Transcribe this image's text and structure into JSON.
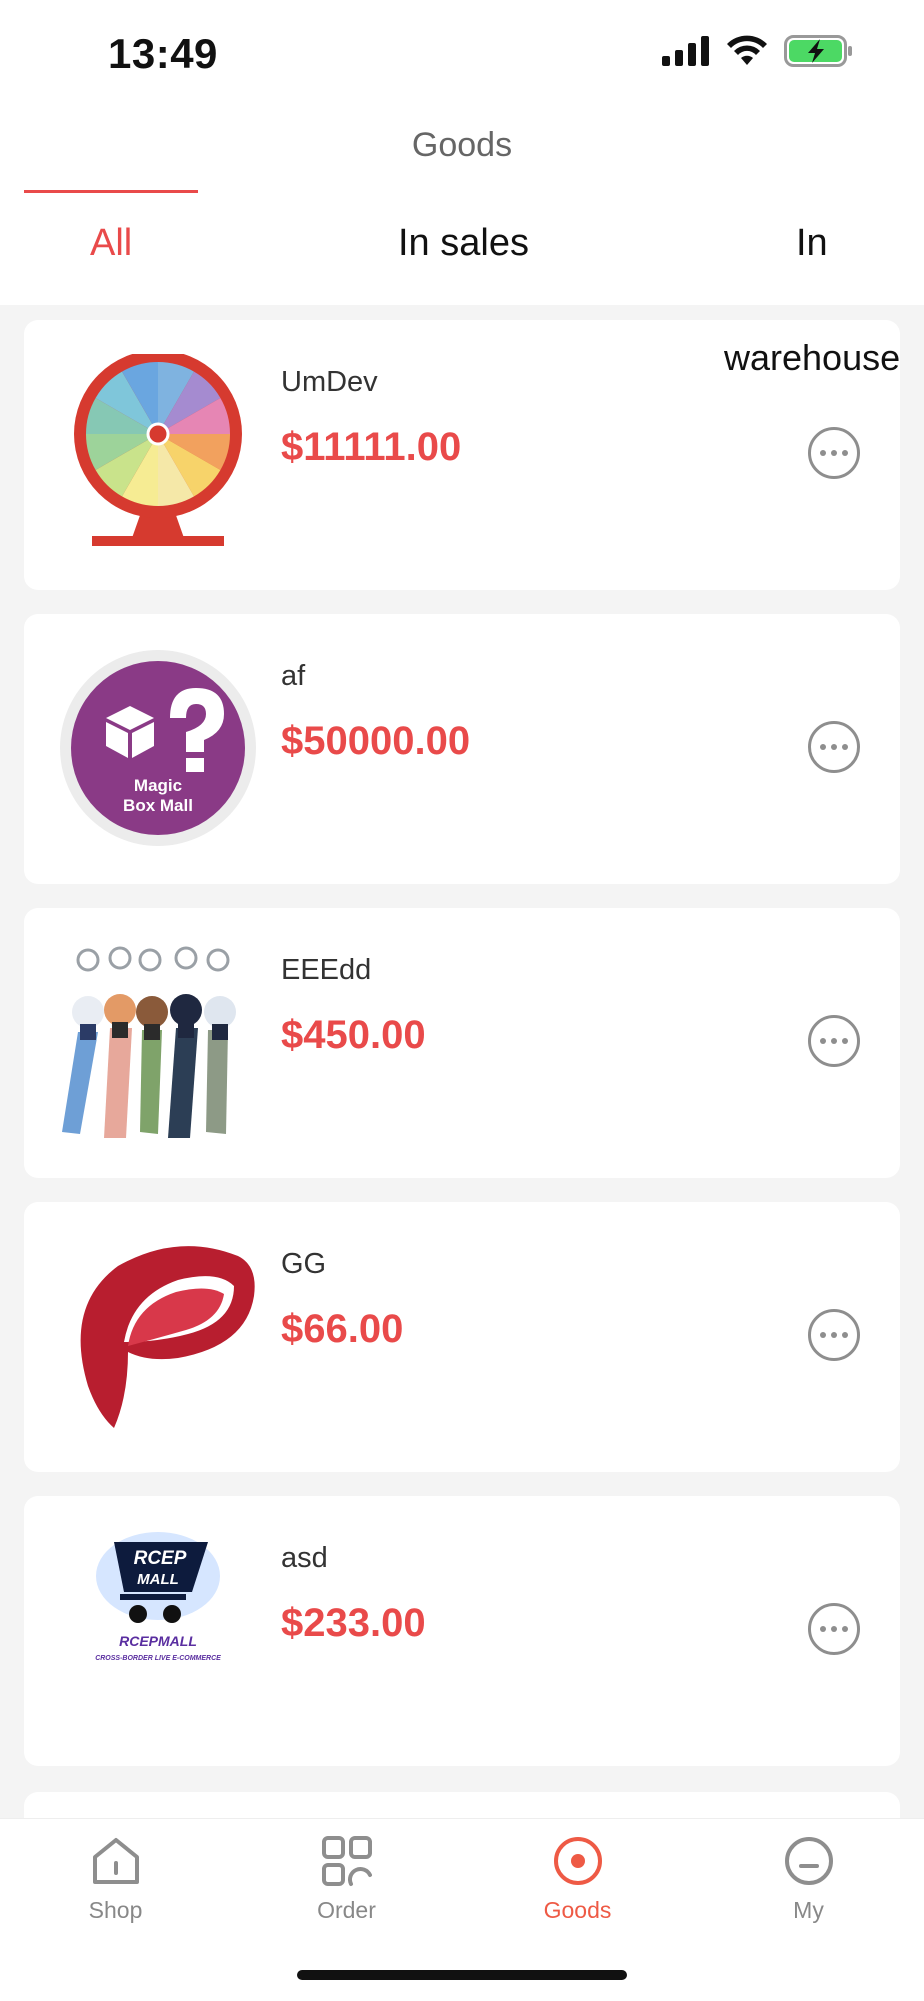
{
  "status_bar": {
    "time": "13:49"
  },
  "header": {
    "title": "Goods"
  },
  "tabs": [
    {
      "label": "All",
      "active": true
    },
    {
      "label": "In sales",
      "active": false
    },
    {
      "label": "In",
      "active": false
    }
  ],
  "tab_overflow_text": "warehouse",
  "products": [
    {
      "name": "UmDev",
      "price": "$11111.00",
      "image": "prize-wheel"
    },
    {
      "name": "af",
      "price": "$50000.00",
      "image": "magic-box-mall-logo",
      "image_text": [
        "Magic",
        "Box Mall"
      ]
    },
    {
      "name": "EEEdd",
      "price": "$450.00",
      "image": "anime-keychains"
    },
    {
      "name": "GG",
      "price": "$66.00",
      "image": "red-p-logo"
    },
    {
      "name": "asd",
      "price": "$233.00",
      "image": "rcep-mall-logo",
      "image_text": [
        "RCEP",
        "MALL",
        "RCEPMALL",
        "CROSS-BORDER LIVE E-COMMERCE"
      ]
    }
  ],
  "bottom_nav": [
    {
      "label": "Shop",
      "icon": "home-icon"
    },
    {
      "label": "Order",
      "icon": "grid-icon"
    },
    {
      "label": "Goods",
      "icon": "target-icon",
      "active": true
    },
    {
      "label": "My",
      "icon": "profile-icon"
    }
  ],
  "colors": {
    "accent": "#e94a4a",
    "nav_active": "#ee5a45",
    "background": "#f4f4f4"
  }
}
